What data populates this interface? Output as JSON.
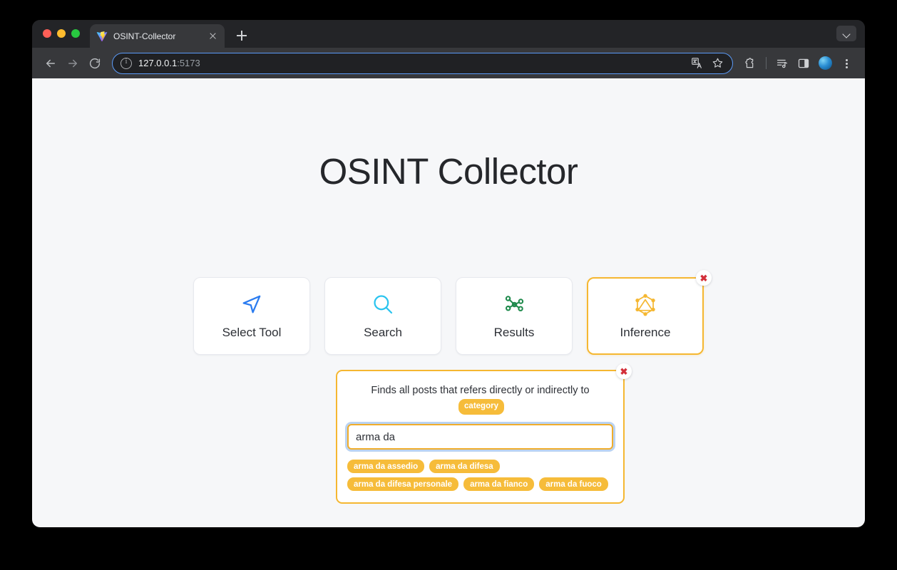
{
  "browser": {
    "tab": {
      "title": "OSINT-Collector",
      "favicon": "vite-logo-icon",
      "close_label": "×"
    },
    "new_tab_label": "+",
    "omnibox": {
      "host": "127.0.0.1",
      "port": ":5173",
      "info_icon": "site-info-icon",
      "translate_icon": "translate-icon",
      "bookmark_icon": "star-icon"
    },
    "toolbar_icons": [
      "back-arrow-icon",
      "forward-arrow-icon",
      "reload-icon",
      "extensions-puzzle-icon",
      "reading-list-icon",
      "side-panel-icon",
      "profile-avatar-icon",
      "kebab-menu-icon"
    ],
    "window_controls": {
      "close": "close-window",
      "minimize": "minimize-window",
      "maximize": "maximize-window",
      "chevron": "chevron-down-icon"
    }
  },
  "page": {
    "title": "OSINT Collector",
    "steps": [
      {
        "label": "Select Tool",
        "icon": "navigation-arrow-icon",
        "color": "#2b7cf0",
        "active": false
      },
      {
        "label": "Search",
        "icon": "magnifier-icon",
        "color": "#2bc4ef",
        "active": false
      },
      {
        "label": "Results",
        "icon": "network-graph-icon",
        "color": "#1f8a4c",
        "active": false
      },
      {
        "label": "Inference",
        "icon": "graphql-icon",
        "color": "#f5b731",
        "active": true
      }
    ],
    "close_badge_label": "✖",
    "query_panel": {
      "description_prefix": "Finds all posts that refers directly or indirectly to",
      "description_chip": "category",
      "input_value": "arma da",
      "input_placeholder": "",
      "suggestions": [
        "arma da assedio",
        "arma da difesa",
        "arma da difesa personale",
        "arma da fianco",
        "arma da fuoco"
      ]
    }
  },
  "colors": {
    "accent_amber": "#f5b731",
    "chip_amber": "#f6bc3a",
    "page_bg": "#f6f7f9",
    "close_red": "#d32f3a"
  }
}
